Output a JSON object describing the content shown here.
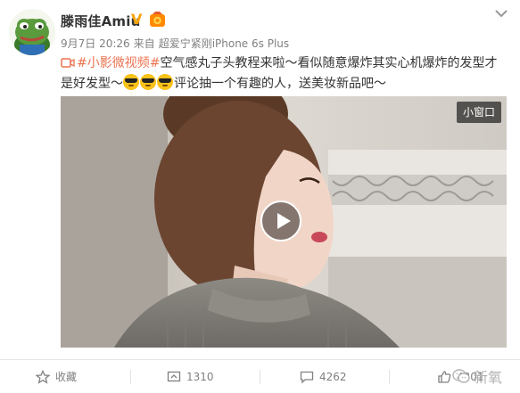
{
  "user": {
    "name": "滕雨佳Amiu",
    "verified_badge": "V",
    "timestamp": "9月7日 20:26",
    "source_prefix": "来自",
    "source": "超爱宁紧刚iPhone 6s Plus"
  },
  "post": {
    "topic": "#小影微视频#",
    "text_part1": "空气感丸子头教程来啦～看似随意爆炸其实心机爆炸的发型才是好发型～",
    "emoji_names": [
      "cool-emoji",
      "cool-emoji",
      "cool-emoji"
    ],
    "text_part2": "评论抽一个有趣的人，送美妆新品吧～"
  },
  "video": {
    "mini_window_label": "小窗口"
  },
  "actions": {
    "favorite_label": "收藏",
    "repost_count": "1310",
    "comment_count": "4262",
    "like_count": "4301"
  },
  "watermark": {
    "text": "新氧"
  },
  "colors": {
    "topic": "#eb7350",
    "meta": "#808080",
    "badge": "#f7a200"
  }
}
